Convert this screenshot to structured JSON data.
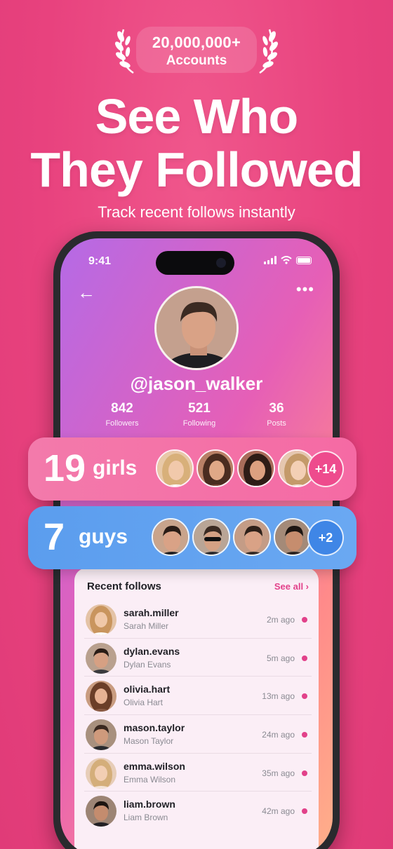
{
  "badge": {
    "count": "20,000,000+",
    "label": "Accounts"
  },
  "headline": {
    "line1": "See Who",
    "line2": "They Followed"
  },
  "subhead": "Track recent follows instantly",
  "phone": {
    "time": "9:41",
    "profile": {
      "username": "@jason_walker",
      "stats": [
        {
          "value": "842",
          "label": "Followers"
        },
        {
          "value": "521",
          "label": "Following"
        },
        {
          "value": "36",
          "label": "Posts"
        }
      ]
    }
  },
  "cards": {
    "girls": {
      "count": "19",
      "label": "girls",
      "more": "+14",
      "accent": "#f56aa4"
    },
    "guys": {
      "count": "7",
      "label": "guys",
      "more": "+2",
      "accent": "#5b9dee"
    }
  },
  "recent": {
    "title": "Recent follows",
    "see_all": "See all ›",
    "items": [
      {
        "user": "sarah.miller",
        "name": "Sarah Miller",
        "time": "2m ago"
      },
      {
        "user": "dylan.evans",
        "name": "Dylan Evans",
        "time": "5m ago"
      },
      {
        "user": "olivia.hart",
        "name": "Olivia Hart",
        "time": "13m ago"
      },
      {
        "user": "mason.taylor",
        "name": "Mason Taylor",
        "time": "24m ago"
      },
      {
        "user": "emma.wilson",
        "name": "Emma Wilson",
        "time": "35m ago"
      },
      {
        "user": "liam.brown",
        "name": "Liam Brown",
        "time": "42m ago"
      }
    ]
  },
  "colors": {
    "background": "#e8427e",
    "accent_pink": "#e2418a"
  }
}
